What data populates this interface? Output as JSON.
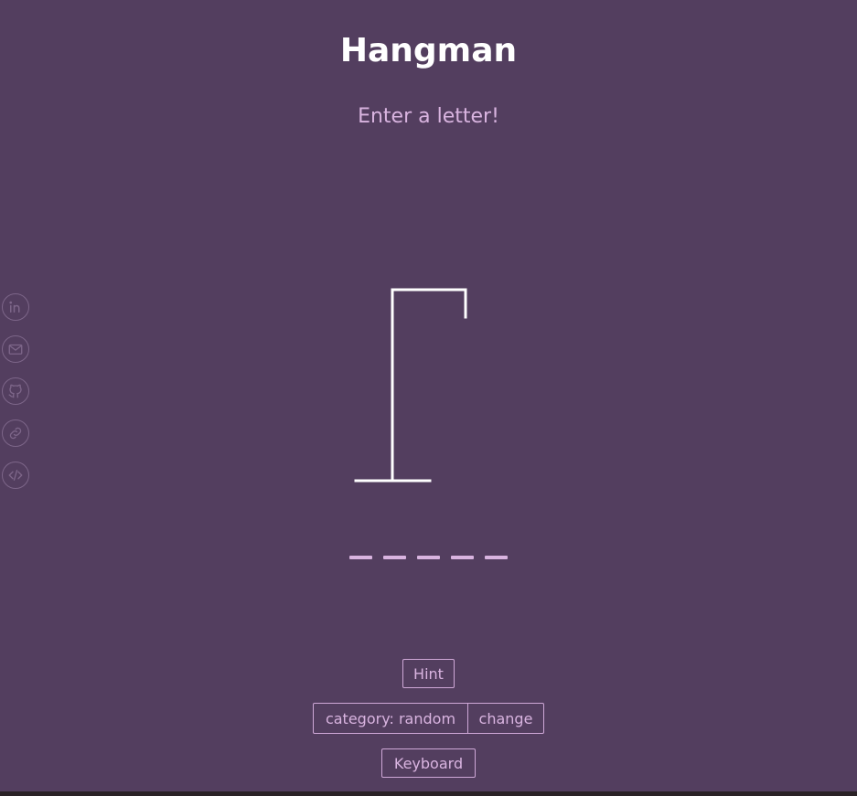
{
  "game": {
    "title": "Hangman",
    "prompt": "Enter a letter!",
    "word_length": 5,
    "wrong_guesses": 0
  },
  "controls": {
    "hint_label": "Hint",
    "category_label": "category: random",
    "change_label": "change",
    "keyboard_label": "Keyboard"
  },
  "social_links": [
    {
      "icon": "linkedin-icon"
    },
    {
      "icon": "mail-icon"
    },
    {
      "icon": "github-icon"
    },
    {
      "icon": "link-icon"
    },
    {
      "icon": "code-icon"
    }
  ],
  "colors": {
    "background": "#533e5f",
    "accent": "#d9b4e0",
    "title": "#ffffff",
    "muted_icon": "#7d6689"
  }
}
